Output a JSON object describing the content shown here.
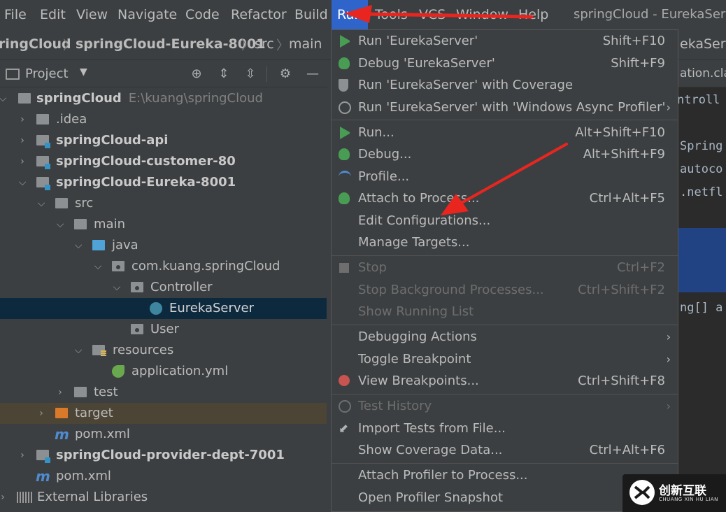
{
  "menubar": {
    "items": [
      "File",
      "Edit",
      "View",
      "Navigate",
      "Code",
      "Refactor",
      "Build",
      "Run",
      "Tools",
      "VCS",
      "Window",
      "Help"
    ],
    "active": "Run",
    "window_title": "springCloud - EurekaServ"
  },
  "breadcrumb": {
    "items": [
      "ringCloud",
      "springCloud-Eureka-8001",
      "src",
      "main"
    ],
    "editor_tab": "ekaServ"
  },
  "project": {
    "title": "Project",
    "tree": [
      {
        "label": "springCloud",
        "path": "E:\\kuang\\springCloud"
      },
      {
        "label": ".idea"
      },
      {
        "label": "springCloud-api"
      },
      {
        "label": "springCloud-customer-80"
      },
      {
        "label": "springCloud-Eureka-8001"
      },
      {
        "label": "src"
      },
      {
        "label": "main"
      },
      {
        "label": "java"
      },
      {
        "label": "com.kuang.springCloud"
      },
      {
        "label": "Controller"
      },
      {
        "label": "EurekaServer"
      },
      {
        "label": "User"
      },
      {
        "label": "resources"
      },
      {
        "label": "application.yml"
      },
      {
        "label": "test"
      },
      {
        "label": "target"
      },
      {
        "label": "pom.xml"
      },
      {
        "label": "springCloud-provider-dept-7001"
      },
      {
        "label": "pom.xml"
      },
      {
        "label": "External Libraries"
      }
    ]
  },
  "editor": {
    "tab": "ation.clas",
    "lines": [
      "ntroll",
      "Spring",
      "autoco",
      ".netfl",
      "ng[] a"
    ]
  },
  "run_menu": {
    "items": [
      {
        "label": "Run 'EurekaServer'",
        "shortcut": "Shift+F10"
      },
      {
        "label": "Debug 'EurekaServer'",
        "shortcut": "Shift+F9"
      },
      {
        "label": "Run 'EurekaServer' with Coverage",
        "shortcut": ""
      },
      {
        "label": "Run 'EurekaServer' with 'Windows Async Profiler'",
        "shortcut": ""
      },
      {
        "label": "Run...",
        "shortcut": "Alt+Shift+F10"
      },
      {
        "label": "Debug...",
        "shortcut": "Alt+Shift+F9"
      },
      {
        "label": "Profile...",
        "shortcut": ""
      },
      {
        "label": "Attach to Process...",
        "shortcut": "Ctrl+Alt+F5"
      },
      {
        "label": "Edit Configurations...",
        "shortcut": ""
      },
      {
        "label": "Manage Targets...",
        "shortcut": ""
      },
      {
        "label": "Stop",
        "shortcut": "Ctrl+F2"
      },
      {
        "label": "Stop Background Processes...",
        "shortcut": "Ctrl+Shift+F2"
      },
      {
        "label": "Show Running List",
        "shortcut": ""
      },
      {
        "label": "Debugging Actions",
        "shortcut": ""
      },
      {
        "label": "Toggle Breakpoint",
        "shortcut": ""
      },
      {
        "label": "View Breakpoints...",
        "shortcut": "Ctrl+Shift+F8"
      },
      {
        "label": "Test History",
        "shortcut": ""
      },
      {
        "label": "Import Tests from File...",
        "shortcut": ""
      },
      {
        "label": "Show Coverage Data...",
        "shortcut": "Ctrl+Alt+F6"
      },
      {
        "label": "Attach Profiler to Process...",
        "shortcut": ""
      },
      {
        "label": "Open Profiler Snapshot",
        "shortcut": ""
      }
    ]
  },
  "watermark": {
    "main": "创新互联",
    "sub": "CHUANG XIN HU LIAN"
  },
  "colors": {
    "menu_active": "#2f65ca",
    "annotation_arrow": "#e8261f",
    "run_green": "#499c54",
    "selection": "#0d293e"
  }
}
